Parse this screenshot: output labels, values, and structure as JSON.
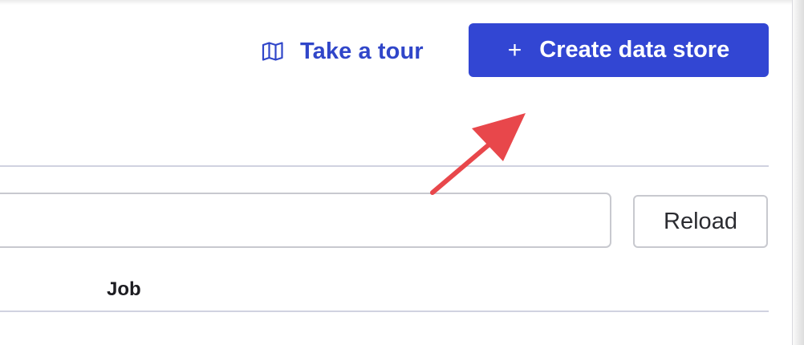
{
  "header": {
    "tour_link_label": "Take a tour",
    "tour_icon": "map-icon",
    "create_button_label": "Create data store",
    "create_button_icon": "plus-icon"
  },
  "toolbar": {
    "search_value": "",
    "search_placeholder": "",
    "reload_label": "Reload"
  },
  "table": {
    "columns": [
      "Job"
    ]
  },
  "annotation": {
    "arrow_color": "#e8474b",
    "target": "create-data-store-button"
  },
  "colors": {
    "accent": "#3246d3",
    "link": "#3046c9",
    "divider": "#d0d2e0"
  }
}
